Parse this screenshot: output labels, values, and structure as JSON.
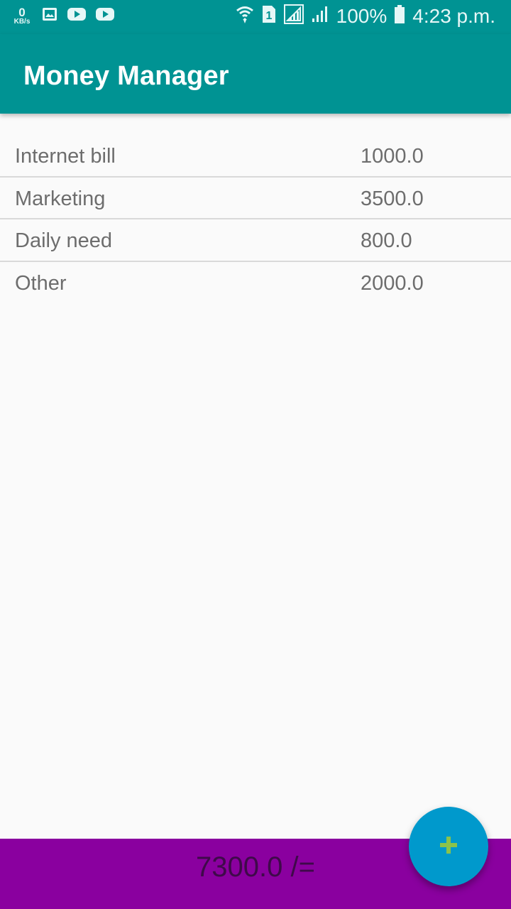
{
  "status_bar": {
    "net_speed_value": "0",
    "net_speed_unit": "KB/s",
    "battery_text": "100%",
    "time": "4:23 p.m.",
    "sim_label": "1",
    "left_icons": [
      "gallery-icon",
      "youtube-icon",
      "youtube-icon"
    ],
    "right_icons": [
      "wifi-icon",
      "sim-icon",
      "signal-icon",
      "signal-icon",
      "battery-icon"
    ]
  },
  "app_bar": {
    "title": "Money Manager",
    "color": "#009393"
  },
  "expenses": [
    {
      "name": "Internet bill",
      "amount": "1000.0"
    },
    {
      "name": "Marketing",
      "amount": "3500.0"
    },
    {
      "name": "Daily need",
      "amount": "800.0"
    },
    {
      "name": "Other",
      "amount": "2000.0"
    }
  ],
  "total": {
    "text": "7300.0 /=",
    "bar_color": "#8a009f"
  },
  "fab": {
    "icon": "plus-icon",
    "color": "#0099cc",
    "icon_color": "#8bc34a"
  }
}
